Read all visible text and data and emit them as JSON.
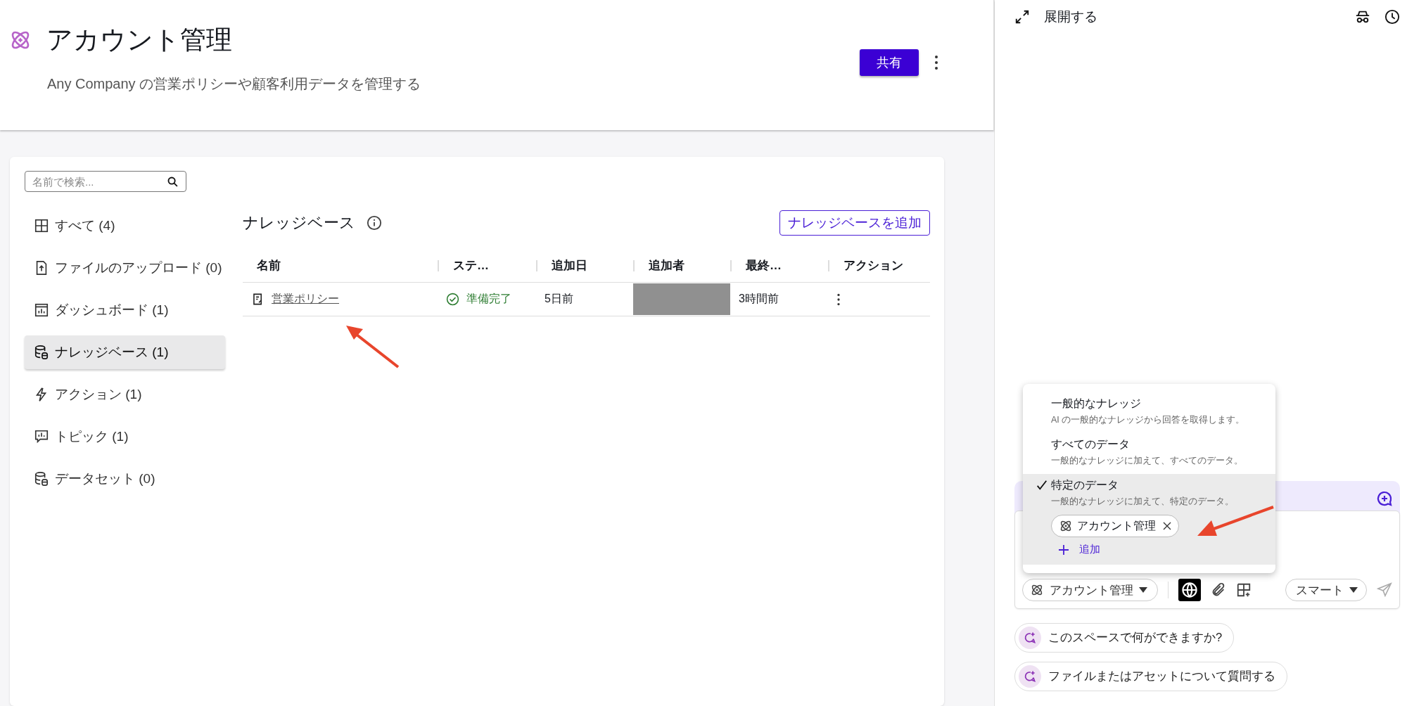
{
  "header": {
    "title": "アカウント管理",
    "subtitle": "Any Company の営業ポリシーや顧客利用データを管理する",
    "share_button": "共有"
  },
  "sidebar": {
    "search": {
      "placeholder": "名前で検索..."
    },
    "items": [
      {
        "kind": "all",
        "label": "すべて (4)",
        "selected": false
      },
      {
        "kind": "upload",
        "label": "ファイルのアップロード (0)",
        "selected": false
      },
      {
        "kind": "dashboard",
        "label": "ダッシュボード (1)",
        "selected": false
      },
      {
        "kind": "knowledge",
        "label": "ナレッジベース (1)",
        "selected": true
      },
      {
        "kind": "action",
        "label": "アクション (1)",
        "selected": false
      },
      {
        "kind": "topic",
        "label": "トピック (1)",
        "selected": false
      },
      {
        "kind": "dataset",
        "label": "データセット (0)",
        "selected": false
      }
    ]
  },
  "knowledge_base": {
    "title": "ナレッジベース",
    "add_button": "ナレッジベースを追加",
    "table": {
      "columns": [
        "名前",
        "ステ…",
        "追加日",
        "追加者",
        "最終…",
        "アクション"
      ],
      "rows": [
        {
          "name": "営業ポリシー",
          "status": "準備完了",
          "added": "5日前",
          "added_by_redacted": true,
          "updated": "3時間前"
        }
      ]
    }
  },
  "assistant": {
    "expand_label": "展開する",
    "source_menu": {
      "options": [
        {
          "title": "一般的なナレッジ",
          "description": "AI の一般的なナレッジから回答を取得します。",
          "selected": false
        },
        {
          "title": "すべてのデータ",
          "description": "一般的なナレッジに加えて、すべてのデータ。",
          "selected": false
        },
        {
          "title": "特定のデータ",
          "description": "一般的なナレッジに加えて、特定のデータ。",
          "selected": true
        }
      ],
      "chips": [
        {
          "label": "アカウント管理"
        }
      ],
      "add_label": "追加"
    },
    "composer": {
      "scope": "アカウント管理",
      "web_search_on": true,
      "mode": "スマート"
    },
    "suggestions": [
      "このスペースで何ができますか?",
      "ファイルまたはアセットについて質問する"
    ]
  }
}
